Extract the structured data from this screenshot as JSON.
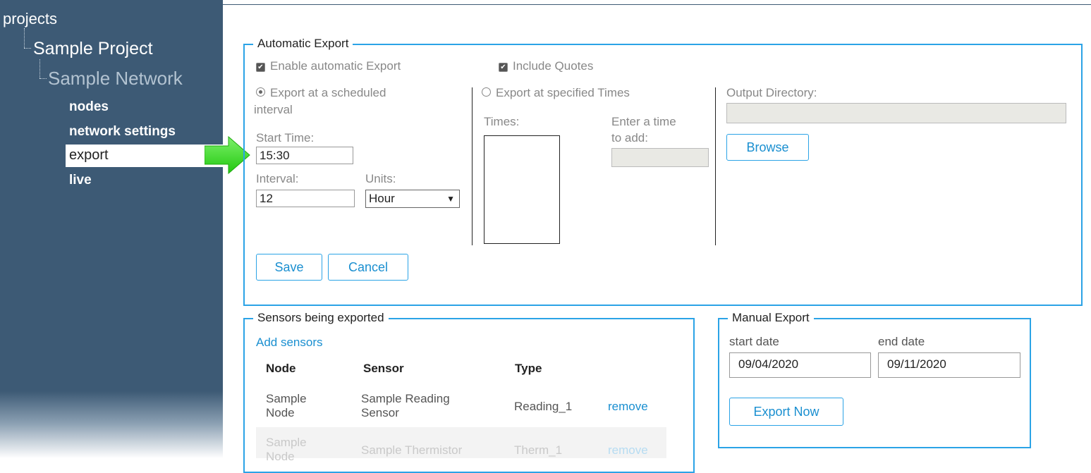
{
  "sidebar": {
    "root": "projects",
    "project": "Sample Project",
    "network": "Sample Network",
    "items": [
      {
        "label": "nodes"
      },
      {
        "label": "network settings"
      },
      {
        "label": "export"
      },
      {
        "label": "live"
      }
    ],
    "selected": "export"
  },
  "automatic_export": {
    "legend": "Automatic Export",
    "enable_label": "Enable automatic Export",
    "enable_checked": true,
    "include_quotes_label": "Include Quotes",
    "include_quotes_checked": true,
    "scheduled_radio_label_line1": "Export at a scheduled",
    "scheduled_radio_label_line2": "interval",
    "scheduled_selected": true,
    "start_time_label": "Start Time:",
    "start_time_value": "15:30",
    "interval_label": "Interval:",
    "interval_value": "12",
    "units_label": "Units:",
    "units_value": "Hour",
    "specified_radio_label": "Export at specified Times",
    "times_label": "Times:",
    "enter_time_label_line1": "Enter a time",
    "enter_time_label_line2": "to add:",
    "enter_time_value": "",
    "output_dir_label": "Output Directory:",
    "output_dir_value": "",
    "browse_label": "Browse",
    "save_label": "Save",
    "cancel_label": "Cancel"
  },
  "sensors": {
    "legend": "Sensors being exported",
    "add_link": "Add sensors",
    "columns": [
      "Node",
      "Sensor",
      "Type"
    ],
    "rows": [
      {
        "node_l1": "Sample",
        "node_l2": "Node",
        "sensor_l1": "Sample Reading",
        "sensor_l2": "Sensor",
        "type": "Reading_1",
        "action": "remove"
      },
      {
        "node_l1": "Sample",
        "node_l2": "Node",
        "sensor_l1": "Sample Thermistor",
        "sensor_l2": "",
        "type": "Therm_1",
        "action": "remove"
      }
    ]
  },
  "manual_export": {
    "legend": "Manual Export",
    "start_label": "start date",
    "start_value": "09/04/2020",
    "end_label": "end date",
    "end_value": "09/11/2020",
    "export_now_label": "Export Now"
  },
  "colors": {
    "sidebar_bg": "#3d5a75",
    "accent": "#2ba3e6",
    "arrow": "#33dd22"
  }
}
